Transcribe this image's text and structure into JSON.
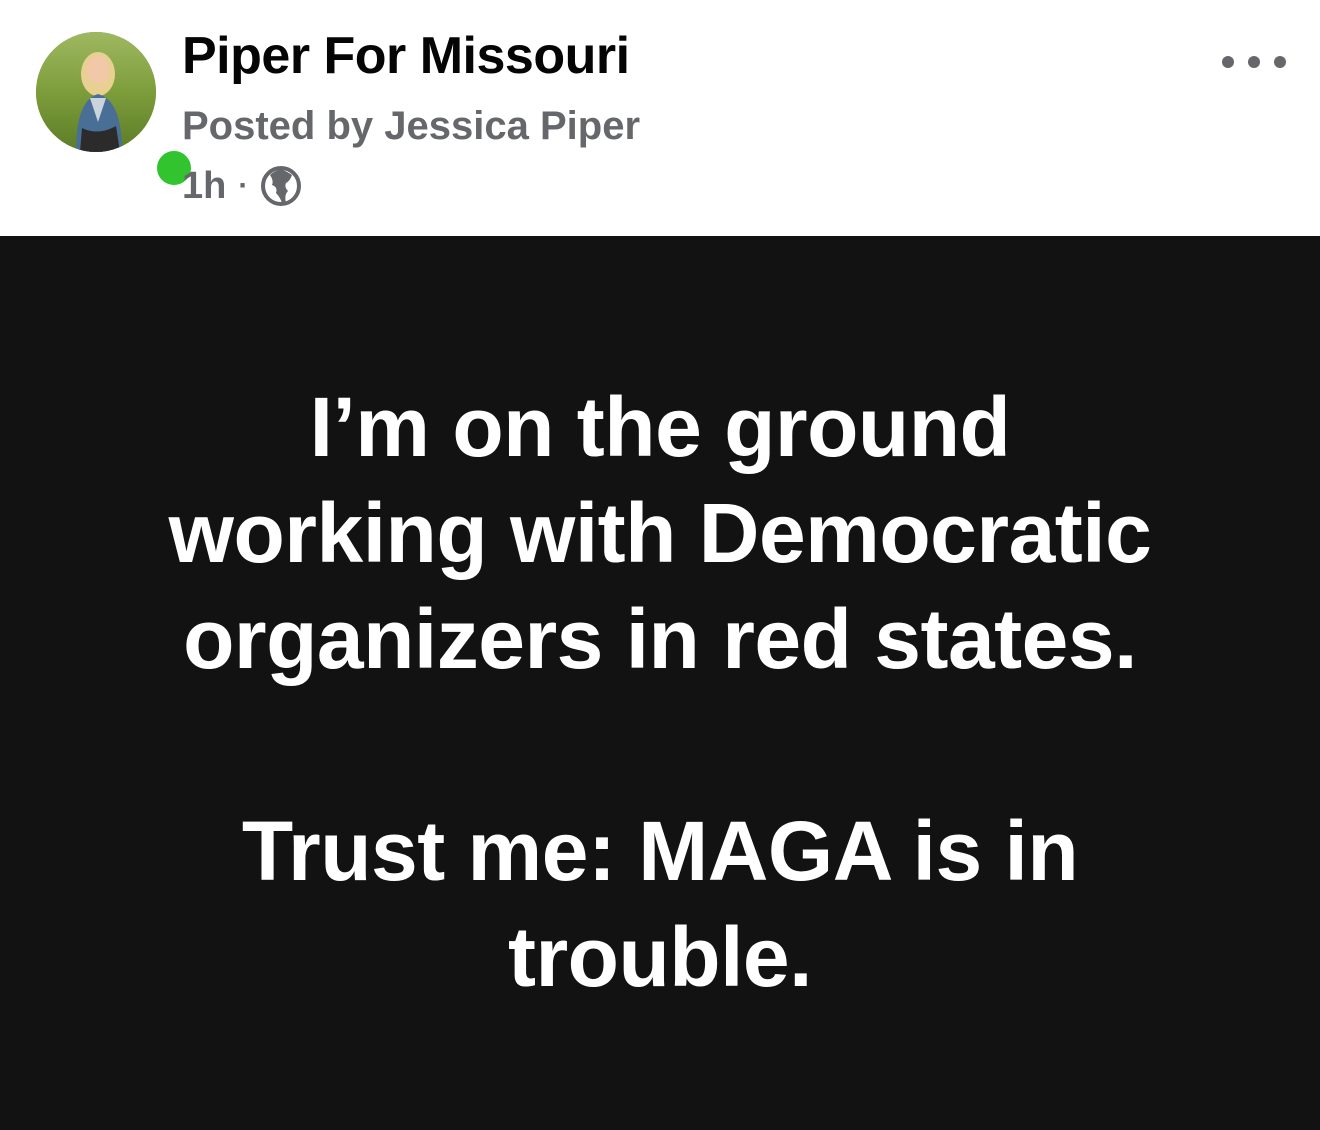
{
  "post": {
    "page_name": "Piper For Missouri",
    "posted_by": "Posted by Jessica Piper",
    "time": "1h",
    "separator": "·",
    "audience_icon": "globe-icon",
    "more_icon": "more-options-icon",
    "avatar_icon": "profile-photo",
    "online_status_color": "#31c42f"
  },
  "image_text": {
    "line1": "I’m on the ground",
    "line2": "working with Democratic",
    "line3": "organizers in red states.",
    "line4": "Trust me: MAGA is in",
    "line5": "trouble."
  }
}
